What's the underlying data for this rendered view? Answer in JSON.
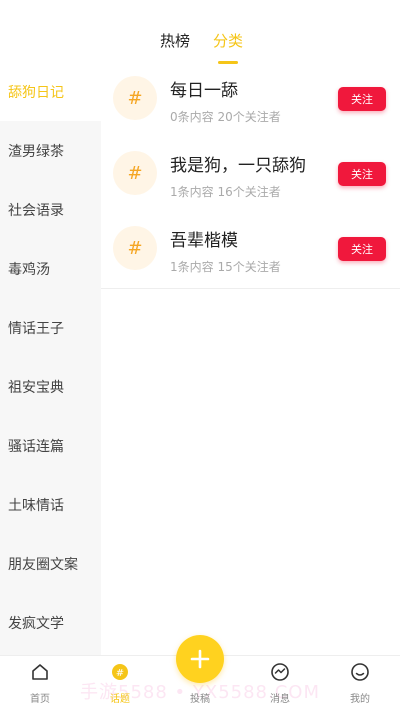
{
  "top_tabs": [
    {
      "label": "热榜",
      "active": false
    },
    {
      "label": "分类",
      "active": true
    }
  ],
  "sidebar": {
    "items": [
      {
        "label": "舔狗日记",
        "active": true
      },
      {
        "label": "渣男绿茶",
        "active": false
      },
      {
        "label": "社会语录",
        "active": false
      },
      {
        "label": "毒鸡汤",
        "active": false
      },
      {
        "label": "情话王子",
        "active": false
      },
      {
        "label": "祖安宝典",
        "active": false
      },
      {
        "label": "骚话连篇",
        "active": false
      },
      {
        "label": "土味情话",
        "active": false
      },
      {
        "label": "朋友圈文案",
        "active": false
      },
      {
        "label": "发疯文学",
        "active": false
      }
    ]
  },
  "topics": [
    {
      "icon": "#",
      "title": "每日一舔",
      "meta": "0条内容 20个关注者",
      "button": "关注"
    },
    {
      "icon": "#",
      "title": "我是狗，一只舔狗",
      "meta": "1条内容 16个关注者",
      "button": "关注"
    },
    {
      "icon": "#",
      "title": "吾辈楷模",
      "meta": "1条内容 15个关注者",
      "button": "关注"
    }
  ],
  "bottom_nav": {
    "items": [
      {
        "label": "首页",
        "icon": "home-icon",
        "active": false
      },
      {
        "label": "话题",
        "icon": "topic-icon",
        "active": true
      },
      {
        "label": "投稿",
        "icon": "plus-icon",
        "active": false
      },
      {
        "label": "消息",
        "icon": "message-icon",
        "active": false
      },
      {
        "label": "我的",
        "icon": "profile-icon",
        "active": false
      }
    ],
    "watermark": "手游5588 • YX5588.COM"
  },
  "colors": {
    "accent": "#f5c518",
    "follow_button": "#f0183c",
    "fab": "#ffd21f",
    "topic_icon": "#f5a623"
  }
}
